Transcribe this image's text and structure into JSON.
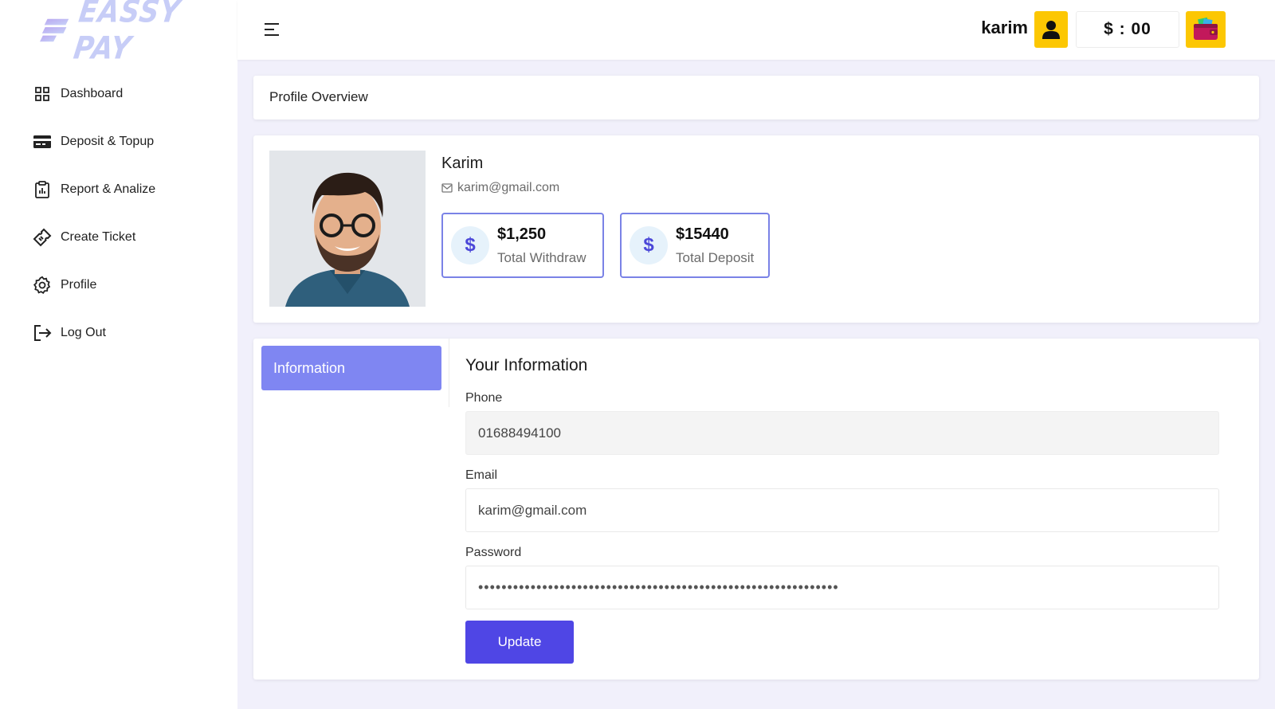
{
  "brand": {
    "name": "EASSY PAY"
  },
  "sidebar": {
    "items": [
      {
        "label": "Dashboard",
        "icon": "grid-icon"
      },
      {
        "label": "Deposit & Topup",
        "icon": "credit-card-icon"
      },
      {
        "label": "Report & Analize",
        "icon": "clipboard-report-icon"
      },
      {
        "label": "Create Ticket",
        "icon": "ticket-icon"
      },
      {
        "label": "Profile",
        "icon": "gear-icon"
      },
      {
        "label": "Log Out",
        "icon": "logout-icon"
      }
    ]
  },
  "topbar": {
    "username": "karim",
    "balance": "$ : 00",
    "user_icon": "user-icon",
    "wallet_icon": "wallet-icon"
  },
  "overview": {
    "title": "Profile Overview"
  },
  "profile": {
    "name": "Karim",
    "email": "karim@gmail.com",
    "stats": [
      {
        "value": "$1,250",
        "label": "Total Withdraw",
        "icon": "dollar-icon"
      },
      {
        "value": "$15440",
        "label": "Total Deposit",
        "icon": "dollar-icon"
      }
    ]
  },
  "info": {
    "tab_label": "Information",
    "section_title": "Your Information",
    "phone_label": "Phone",
    "phone_value": "01688494100",
    "email_label": "Email",
    "email_value": "karim@gmail.com",
    "password_label": "Password",
    "password_value": "••••••••••••••••••••••••••••••••••••••••••••••••••••••••••••••",
    "update_label": "Update"
  },
  "colors": {
    "accent": "#4f46e5",
    "tab_active": "#7f86f2",
    "yellow": "#fcc703",
    "stat_border": "#7a82e6",
    "background": "#f1f0fb"
  }
}
